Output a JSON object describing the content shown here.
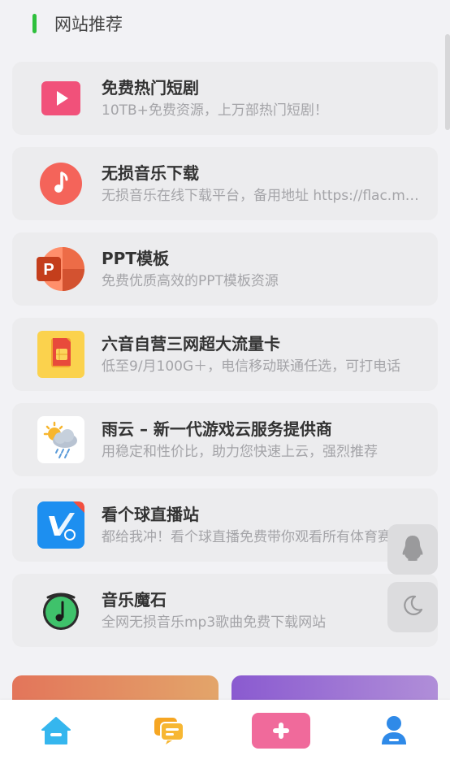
{
  "section": {
    "title": "网站推荐"
  },
  "colors": {
    "accent_green": "#2ec03c",
    "card_bg": "#ececee",
    "page_bg": "#f2f2f5",
    "plus_button": "#f06a9b"
  },
  "cards": [
    {
      "title": "免费热门短剧",
      "desc": "10TB+免费资源，上万部热门短剧！",
      "icon": "video-play-icon"
    },
    {
      "title": "无损音乐下载",
      "desc": "无损音乐在线下载平台，备用地址 https://flac.music.hi.cn",
      "icon": "music-note-icon"
    },
    {
      "title": "PPT模板",
      "desc": "免费优质高效的PPT模板资源",
      "icon": "powerpoint-icon"
    },
    {
      "title": "六音自营三网超大流量卡",
      "desc": "低至9/月100G＋，电信移动联通任选，可打电话",
      "icon": "sim-card-icon"
    },
    {
      "title": "雨云 – 新一代游戏云服务提供商",
      "desc": "用稳定和性价比，助力您快速上云，强烈推荐",
      "icon": "weather-cloud-icon"
    },
    {
      "title": "看个球直播站",
      "desc": "都给我冲！看个球直播免费带你观看所有体育赛事",
      "icon": "sports-live-icon"
    },
    {
      "title": "音乐魔石",
      "desc": "全网无损音乐mp3歌曲免费下载网站",
      "icon": "music-disc-icon"
    }
  ],
  "floating": [
    {
      "icon": "qq-penguin-icon"
    },
    {
      "icon": "moon-icon"
    }
  ],
  "tabbar": [
    {
      "icon": "home-icon"
    },
    {
      "icon": "chat-icon"
    },
    {
      "icon": "plus-icon"
    },
    {
      "icon": "user-icon"
    }
  ]
}
